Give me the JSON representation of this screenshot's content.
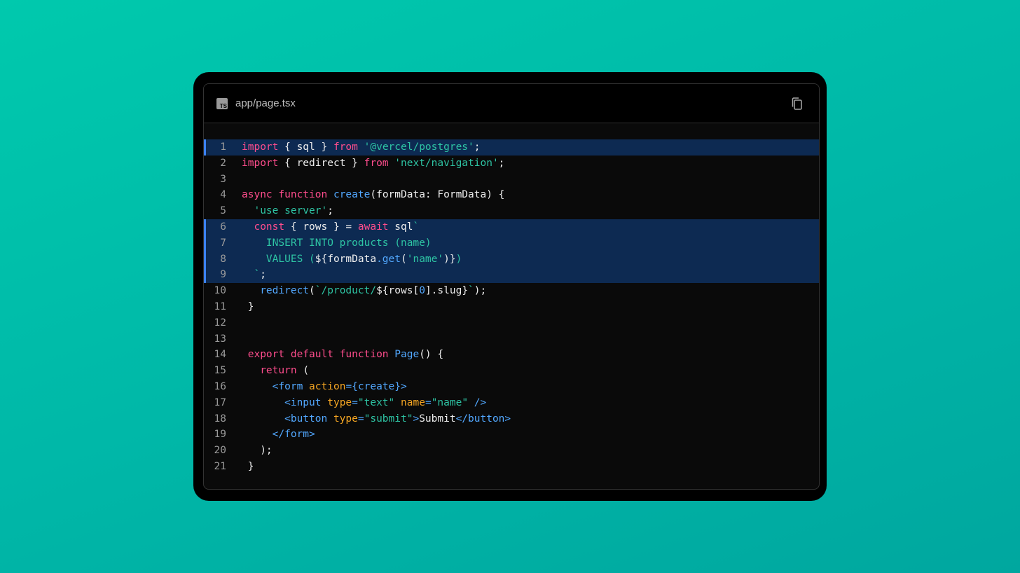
{
  "file": {
    "icon": "typescript-file-icon",
    "icon_label": "TS",
    "name": "app/page.tsx"
  },
  "copy_icon": "copy-icon",
  "colors": {
    "background_gradient": [
      "#00c9ad",
      "#00a79f"
    ],
    "keyword": "#ff4d8d",
    "string": "#2ec4a4",
    "function": "#52a8ff",
    "attribute": "#f5a623",
    "highlight_bg": "#0d2a52",
    "highlight_bar": "#3b82f6"
  },
  "highlighted_lines": [
    1,
    6,
    7,
    8,
    9
  ],
  "lines": [
    {
      "n": "1",
      "tokens": [
        [
          "k",
          "import"
        ],
        [
          "p",
          " { sql } "
        ],
        [
          "k",
          "from"
        ],
        [
          "p",
          " "
        ],
        [
          "s",
          "'@vercel/postgres'"
        ],
        [
          "p",
          ";"
        ]
      ]
    },
    {
      "n": "2",
      "tokens": [
        [
          "k",
          "import"
        ],
        [
          "p",
          " { redirect } "
        ],
        [
          "k",
          "from"
        ],
        [
          "p",
          " "
        ],
        [
          "s",
          "'next/navigation'"
        ],
        [
          "p",
          ";"
        ]
      ]
    },
    {
      "n": "3",
      "tokens": []
    },
    {
      "n": "4",
      "tokens": [
        [
          "k",
          "async"
        ],
        [
          "p",
          " "
        ],
        [
          "k",
          "function"
        ],
        [
          "p",
          " "
        ],
        [
          "f",
          "create"
        ],
        [
          "p",
          "(formData: FormData) {"
        ]
      ]
    },
    {
      "n": "5",
      "tokens": [
        [
          "p",
          "  "
        ],
        [
          "s",
          "'use server'"
        ],
        [
          "p",
          ";"
        ]
      ]
    },
    {
      "n": "6",
      "tokens": [
        [
          "p",
          "  "
        ],
        [
          "k",
          "const"
        ],
        [
          "p",
          " { rows } = "
        ],
        [
          "k",
          "await"
        ],
        [
          "p",
          " sql"
        ],
        [
          "s",
          "`"
        ]
      ]
    },
    {
      "n": "7",
      "tokens": [
        [
          "s",
          "    INSERT INTO products (name)"
        ]
      ]
    },
    {
      "n": "8",
      "tokens": [
        [
          "s",
          "    VALUES ("
        ],
        [
          "p",
          "${formData"
        ],
        [
          "f",
          ".get"
        ],
        [
          "p",
          "("
        ],
        [
          "s",
          "'name'"
        ],
        [
          "p",
          ")}"
        ],
        [
          "s",
          ")"
        ]
      ]
    },
    {
      "n": "9",
      "tokens": [
        [
          "s",
          "  `"
        ],
        [
          "p",
          ";"
        ]
      ]
    },
    {
      "n": "10",
      "tokens": [
        [
          "p",
          "   "
        ],
        [
          "f",
          "redirect"
        ],
        [
          "p",
          "("
        ],
        [
          "s",
          "`/product/"
        ],
        [
          "p",
          "${rows["
        ],
        [
          "f",
          "0"
        ],
        [
          "p",
          "].slug}"
        ],
        [
          "s",
          "`"
        ],
        [
          "p",
          ");"
        ]
      ]
    },
    {
      "n": "11",
      "tokens": [
        [
          "p",
          " }"
        ]
      ]
    },
    {
      "n": "12",
      "tokens": []
    },
    {
      "n": "13",
      "tokens": []
    },
    {
      "n": "14",
      "tokens": [
        [
          "p",
          " "
        ],
        [
          "k",
          "export"
        ],
        [
          "p",
          " "
        ],
        [
          "k",
          "default"
        ],
        [
          "p",
          " "
        ],
        [
          "k",
          "function"
        ],
        [
          "p",
          " "
        ],
        [
          "f",
          "Page"
        ],
        [
          "p",
          "() {"
        ]
      ]
    },
    {
      "n": "15",
      "tokens": [
        [
          "p",
          "   "
        ],
        [
          "k",
          "return"
        ],
        [
          "p",
          " ("
        ]
      ]
    },
    {
      "n": "16",
      "tokens": [
        [
          "p",
          "     "
        ],
        [
          "t",
          "<form"
        ],
        [
          "p",
          " "
        ],
        [
          "a",
          "action"
        ],
        [
          "t",
          "={create}>"
        ]
      ]
    },
    {
      "n": "17",
      "tokens": [
        [
          "p",
          "       "
        ],
        [
          "t",
          "<input"
        ],
        [
          "p",
          " "
        ],
        [
          "a",
          "type"
        ],
        [
          "t",
          "="
        ],
        [
          "s",
          "\"text\""
        ],
        [
          "p",
          " "
        ],
        [
          "a",
          "name"
        ],
        [
          "t",
          "="
        ],
        [
          "s",
          "\"name\""
        ],
        [
          "p",
          " "
        ],
        [
          "t",
          "/>"
        ]
      ]
    },
    {
      "n": "18",
      "tokens": [
        [
          "p",
          "       "
        ],
        [
          "t",
          "<button"
        ],
        [
          "p",
          " "
        ],
        [
          "a",
          "type"
        ],
        [
          "t",
          "="
        ],
        [
          "s",
          "\"submit\""
        ],
        [
          "t",
          ">"
        ],
        [
          "p",
          "Submit"
        ],
        [
          "t",
          "</button>"
        ]
      ]
    },
    {
      "n": "19",
      "tokens": [
        [
          "p",
          "     "
        ],
        [
          "t",
          "</form>"
        ]
      ]
    },
    {
      "n": "20",
      "tokens": [
        [
          "p",
          "   );"
        ]
      ]
    },
    {
      "n": "21",
      "tokens": [
        [
          "p",
          " }"
        ]
      ]
    }
  ]
}
